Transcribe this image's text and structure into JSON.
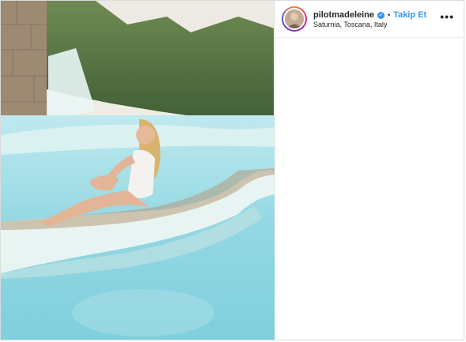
{
  "post": {
    "username": "pilotmadeleine",
    "separator": "•",
    "follow_label": "Takip Et",
    "location": "Saturnia, Toscana, Italy",
    "more_label": "•••",
    "verified_glyph": "✓"
  },
  "icons": {
    "verified": "verified-badge-icon",
    "more": "more-options-icon"
  },
  "colors": {
    "link_blue": "#3897f0",
    "text": "#262626",
    "border": "#dbdbdb",
    "water": "#8fd3e0"
  }
}
